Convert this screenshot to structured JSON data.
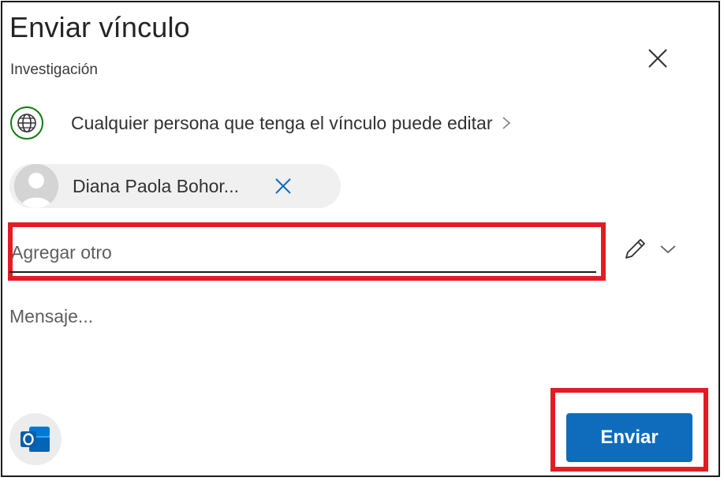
{
  "dialog": {
    "title": "Enviar vínculo",
    "subtitle": "Investigación",
    "close_icon": "close-icon"
  },
  "link_setting": {
    "icon": "globe-icon",
    "text": "Cualquier persona que tenga el vínculo puede editar",
    "chevron_icon": "chevron-right-icon"
  },
  "recipients": [
    {
      "name": "Diana Paola Bohor...",
      "avatar_icon": "person-avatar-icon",
      "remove_icon": "close-icon"
    }
  ],
  "add_recipient": {
    "placeholder": "Agregar otro",
    "value": "",
    "permission_icon": "pencil-icon",
    "dropdown_icon": "chevron-down-icon"
  },
  "message": {
    "placeholder": "Mensaje...",
    "value": ""
  },
  "footer": {
    "outlook_icon": "outlook-icon",
    "send_label": "Enviar"
  },
  "colors": {
    "primary": "#0f6cbd",
    "highlight": "#e51b24",
    "globe": "#107c10"
  }
}
